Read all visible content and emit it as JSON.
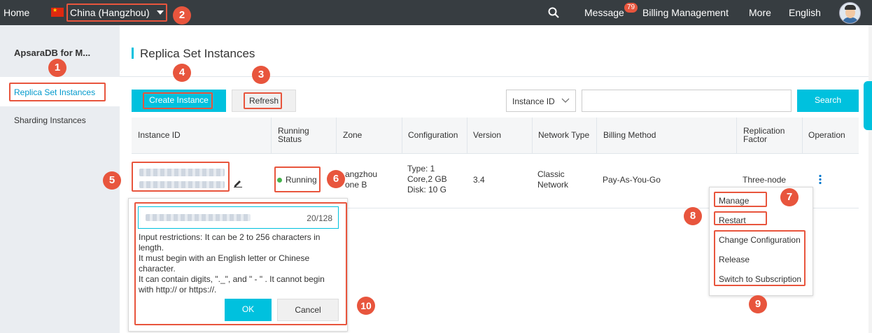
{
  "topbar": {
    "home": "Home",
    "region": "China (Hangzhou)",
    "message": "Message",
    "message_count": "79",
    "billing": "Billing Management",
    "more": "More",
    "language": "English"
  },
  "sidebar": {
    "brand": "ApsaraDB for M...",
    "items": [
      "Replica Set Instances",
      "Sharding Instances"
    ]
  },
  "page": {
    "title": "Replica Set Instances"
  },
  "toolbar": {
    "create_label": "Create Instance",
    "refresh_label": "Refresh",
    "filter_select": "Instance ID",
    "search_label": "Search",
    "search_value": ""
  },
  "table": {
    "headers": {
      "instance_id": "Instance ID",
      "running_status_1": "Running",
      "running_status_2": "Status",
      "zone": "Zone",
      "configuration": "Configuration",
      "version": "Version",
      "network_type": "Network Type",
      "billing_method": "Billing Method",
      "replication_factor_1": "Replication",
      "replication_factor_2": "Factor",
      "operation": "Operation"
    },
    "row": {
      "status": "Running",
      "zone_1": "angzhou",
      "zone_2": "one B",
      "config_1": "Type: 1",
      "config_2": "Core,2 GB",
      "config_3": "Disk: 10 G",
      "version": "3.4",
      "network_1": "Classic",
      "network_2": "Network",
      "billing": "Pay-As-You-Go",
      "replication": "Three-node"
    }
  },
  "operation_menu": {
    "items": [
      "Manage",
      "Restart",
      "Change Configuration",
      "Release",
      "Switch to Subscription"
    ]
  },
  "edit_popover": {
    "counter": "20/128",
    "help_lines": [
      "Input restrictions: It can be 2 to 256 characters in",
      "length.",
      "It must begin with an English letter or Chinese",
      "character.",
      "It can contain digits, \"._\", and \" - \" . It cannot begin",
      "with http:// or https://."
    ],
    "ok_label": "OK",
    "cancel_label": "Cancel"
  },
  "callouts": [
    "1",
    "2",
    "3",
    "4",
    "5",
    "6",
    "7",
    "8",
    "9",
    "10"
  ],
  "colors": {
    "topbar_bg": "#373d41",
    "accent": "#00c1de",
    "highlight": "#e8553d",
    "sidebar_bg": "#eaedf1",
    "running": "#45b24b"
  }
}
